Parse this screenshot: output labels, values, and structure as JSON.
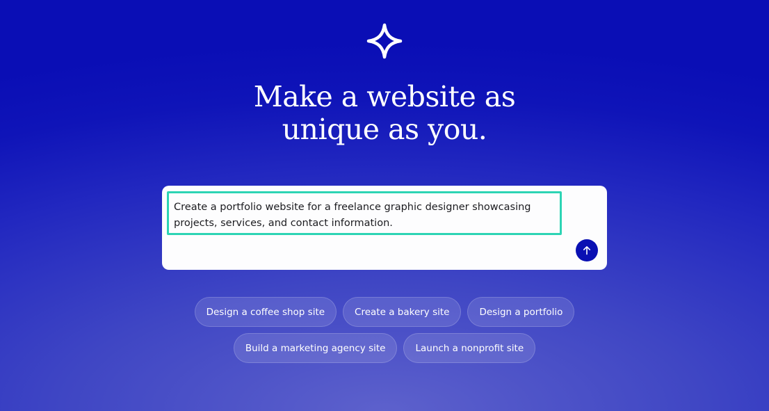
{
  "logo": {
    "icon": "sparkle-star-icon"
  },
  "hero": {
    "line1": "Make a website as",
    "line2": "unique as you."
  },
  "prompt": {
    "value": "Create a portfolio website for a freelance graphic designer showcasing projects, services, and contact information.",
    "send_icon": "arrow-up-icon"
  },
  "suggestions": {
    "row1": [
      "Design a coffee shop site",
      "Create a bakery site",
      "Design a portfolio"
    ],
    "row2": [
      "Build a marketing agency site",
      "Launch a nonprofit site"
    ]
  },
  "colors": {
    "background_top": "#0a0eb5",
    "background_bottom": "#5d61cc",
    "accent_button": "#0a10b3",
    "focus_border": "#2dd4b4"
  }
}
